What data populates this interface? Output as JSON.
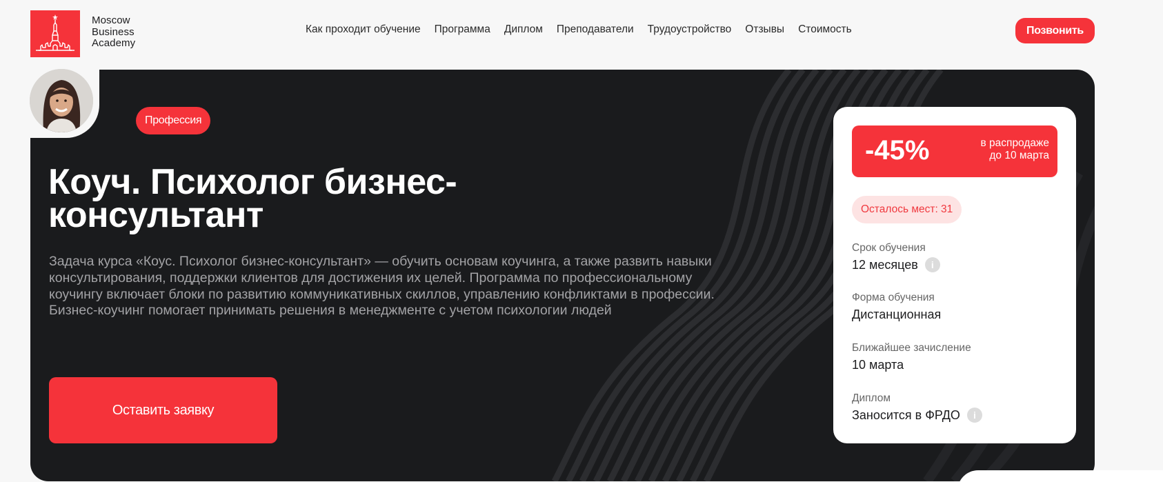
{
  "brand": {
    "name_lines": [
      "Moscow",
      "Business",
      "Academy"
    ],
    "accent_color": "#f5333a"
  },
  "nav": {
    "items": [
      "Как проходит обучение",
      "Программа",
      "Диплом",
      "Преподаватели",
      "Трудоустройство",
      "Отзывы",
      "Стоимость"
    ]
  },
  "header": {
    "call_label": "Позвонить"
  },
  "hero": {
    "badge": "Профессия",
    "title_line1": "Коуч. Психолог бизнес-",
    "title_line2": "консультант",
    "description": "Задача курса «Коус. Психолог бизнес-консультант» — обучить основам коучинга, а также развить навыки консультирования, поддержки клиентов для достижения их целей. Программа по профессиональному коучингу включает блоки по развитию коммуникативных скиллов, управлению конфликтами в профессии. Бизнес-коучинг помогает принимать решения в менеджменте с учетом психологии людей",
    "cta_label": "Оставить заявку",
    "background_color": "#1a1b1d"
  },
  "card": {
    "discount": "-45%",
    "discount_note_line1": "в распродаже",
    "discount_note_line2": "до 10 марта",
    "seats": "Осталось мест: 31",
    "duration_label": "Срок обучения",
    "duration_value": "12 месяцев",
    "format_label": "Форма обучения",
    "format_value": "Дистанционная",
    "enrollment_label": "Ближайшее зачисление",
    "enrollment_value": "10 марта",
    "diploma_label": "Диплом",
    "diploma_value": "Заносится в ФРДО",
    "info_icon_glyph": "i"
  }
}
